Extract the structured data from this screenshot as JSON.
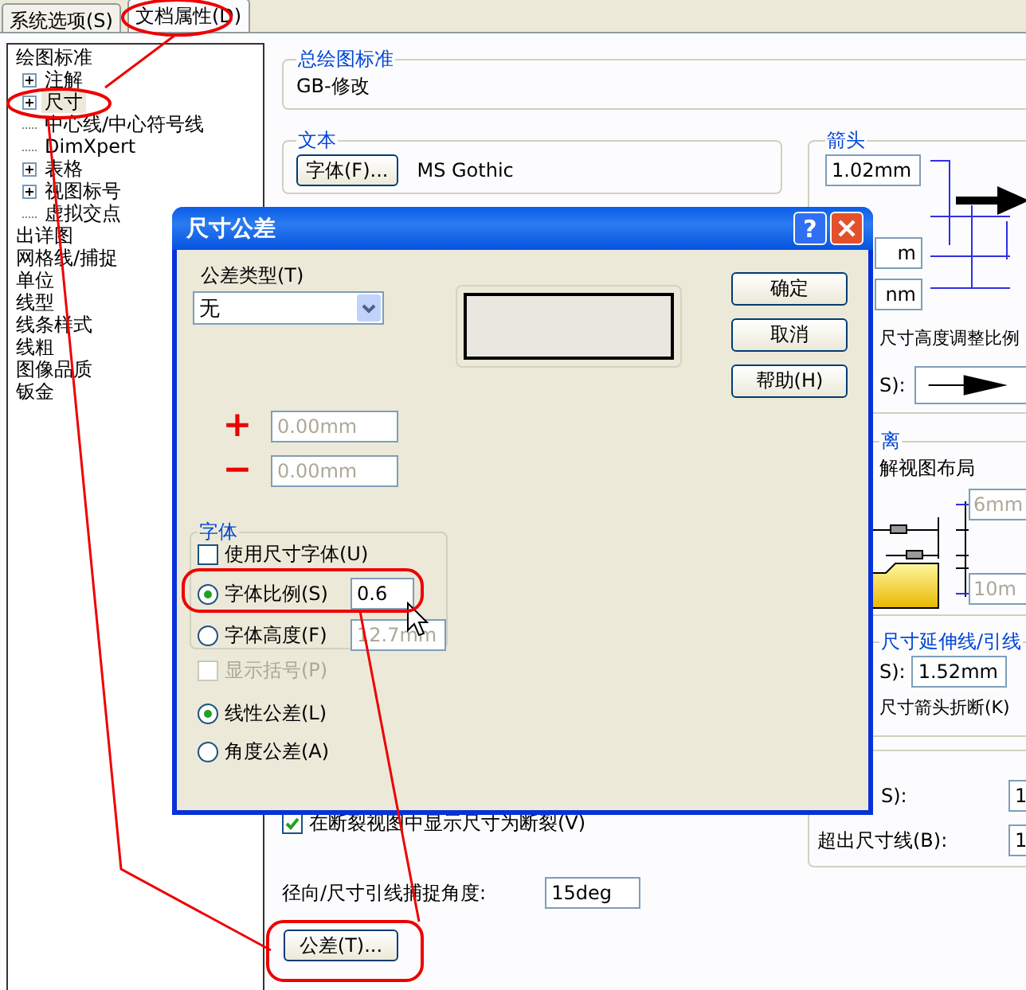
{
  "tabs": [
    {
      "label": "系统选项(S)",
      "selected": false
    },
    {
      "label": "文档属性(D)",
      "selected": true
    }
  ],
  "tree": [
    {
      "label": "绘图标准",
      "selected": false,
      "children": [
        {
          "label": "注解",
          "selected": false,
          "has_children": true
        },
        {
          "label": "尺寸",
          "selected": true,
          "has_children": true
        },
        {
          "label": "中心线/中心符号线",
          "selected": false,
          "has_children": false
        },
        {
          "label": "DimXpert",
          "selected": false,
          "has_children": false
        },
        {
          "label": "表格",
          "selected": false,
          "has_children": true
        },
        {
          "label": "视图标号",
          "selected": false,
          "has_children": true
        },
        {
          "label": "虚拟交点",
          "selected": false,
          "has_children": false
        }
      ]
    },
    {
      "label": "出详图",
      "selected": false
    },
    {
      "label": "网格线/捕捉",
      "selected": false
    },
    {
      "label": "单位",
      "selected": false
    },
    {
      "label": "线型",
      "selected": false
    },
    {
      "label": "线条样式",
      "selected": false
    },
    {
      "label": "线粗",
      "selected": false
    },
    {
      "label": "图像品质",
      "selected": false
    },
    {
      "label": "钣金",
      "selected": false
    }
  ],
  "standard": {
    "title": "总绘图标准",
    "value": "GB-修改"
  },
  "text_group": {
    "title": "文本",
    "button": "字体(F)...",
    "font": "MS Gothic"
  },
  "arrows": {
    "title": "箭头",
    "size": "1.02mm",
    "fields": [
      "m",
      "nm"
    ],
    "scale_label": "尺寸高度调整比例",
    "style_label": "S):"
  },
  "distance": {
    "title": "离",
    "label": "解视图布局",
    "fields": [
      "6mm",
      "10m"
    ]
  },
  "extension": {
    "title": "尺寸延伸线/引线",
    "label": "S):",
    "value": "1.52mm",
    "note": "尺寸箭头折断(K)"
  },
  "offset": [
    {
      "label": "S):",
      "value": "1"
    },
    {
      "label": "超出尺寸线(B):",
      "value": "1"
    }
  ],
  "break_checkbox": {
    "label": "在断裂视图中显示尺寸为断裂(V)",
    "checked": true
  },
  "snap": {
    "label": "径向/尺寸引线捕捉角度:",
    "value": "15deg"
  },
  "tolerance_button": "公差(T)...",
  "dialog": {
    "title": "尺寸公差",
    "help": "?",
    "type_label": "公差类型(T)",
    "type_value": "无",
    "buttons": [
      "确定",
      "取消",
      "帮助(H)"
    ],
    "limits": [
      {
        "symbol": "+",
        "value": "0.00mm",
        "disabled": true
      },
      {
        "symbol": "−",
        "value": "0.00mm",
        "disabled": true
      }
    ],
    "font_group": {
      "title": "字体",
      "use_dim_font": {
        "label": "使用尺寸字体(U)",
        "checked": false
      },
      "options": [
        {
          "label": "字体比例(S)",
          "selected": true,
          "value": "0.6"
        },
        {
          "label": "字体高度(F)",
          "selected": false,
          "value": "12.7mm"
        }
      ]
    },
    "brackets": {
      "label": "显示括号(P)",
      "checked": false,
      "disabled": true
    },
    "kinds": [
      {
        "label": "线性公差(L)",
        "selected": true
      },
      {
        "label": "角度公差(A)",
        "selected": false
      }
    ]
  }
}
